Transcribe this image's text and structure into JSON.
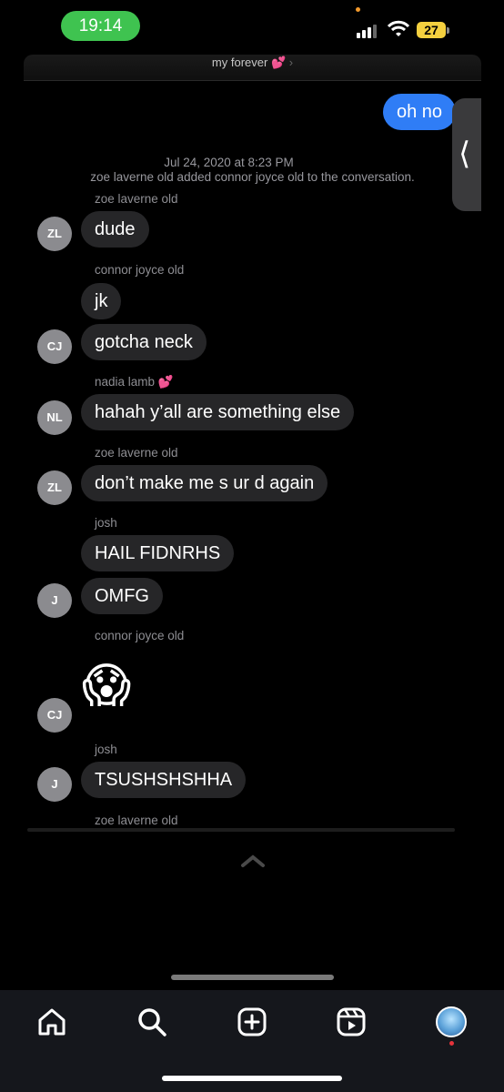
{
  "status_bar": {
    "time": "19:14",
    "battery": "27",
    "accent_green": "#3fc350",
    "battery_color": "#f4d03f"
  },
  "chat": {
    "title": "my forever",
    "title_icon": "pink-hearts-emoji",
    "outgoing": "oh no",
    "system_date": "Jul 24, 2020 at 8:23 PM",
    "system_event": "zoe laverne old added connor joyce old to the conversation.",
    "groups": [
      {
        "sender": "zoe laverne old",
        "initials": "ZL",
        "messages": [
          "dude"
        ]
      },
      {
        "sender": "connor joyce old",
        "initials": "CJ",
        "messages": [
          "jk",
          "gotcha neck"
        ]
      },
      {
        "sender": "nadia lamb",
        "sender_icon": "pink-hearts-emoji",
        "initials": "NL",
        "messages": [
          "hahah y’all are something else"
        ]
      },
      {
        "sender": "zoe laverne old",
        "initials": "ZL",
        "messages": [
          "don’t make me s ur d again"
        ]
      },
      {
        "sender": "josh",
        "initials": "J",
        "messages": [
          "HAIL FIDNRHS",
          "OMFG"
        ]
      },
      {
        "sender": "connor joyce old",
        "initials": "CJ",
        "messages": [
          "screaming-emoji"
        ]
      },
      {
        "sender": "josh",
        "initials": "J",
        "messages": [
          "TSUSHSHSHHA"
        ]
      },
      {
        "sender": "zoe laverne old",
        "messages": []
      }
    ],
    "bubble_color": "#262628",
    "outgoing_color": "#2f7df6"
  },
  "tab_bar": {
    "icons": [
      "home-icon",
      "search-icon",
      "create-icon",
      "reels-icon",
      "profile-avatar"
    ],
    "background": "#15171c"
  }
}
